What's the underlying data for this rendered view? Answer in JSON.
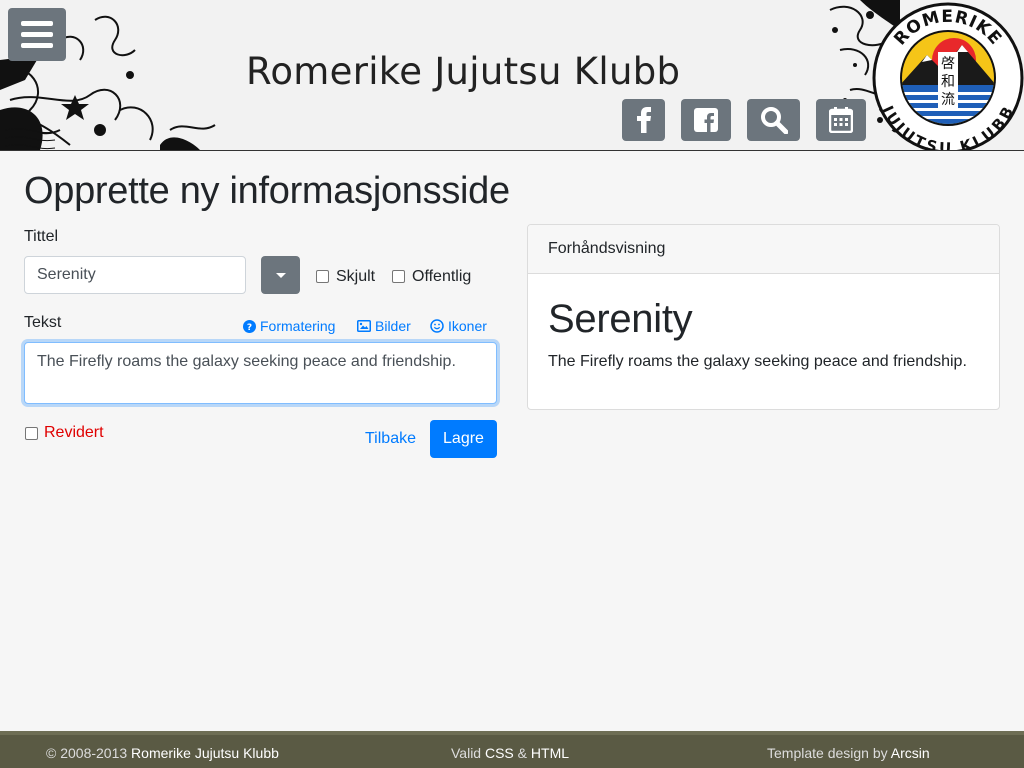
{
  "header": {
    "site_title": "Romerike Jujutsu Klubb",
    "menu_icon": "hamburger-menu-icon",
    "buttons": [
      {
        "icon": "facebook-icon"
      },
      {
        "icon": "facebook-square-icon"
      },
      {
        "icon": "search-icon"
      },
      {
        "icon": "calendar-icon"
      }
    ],
    "logo": {
      "top_text": "ROMERIKE",
      "bottom_text": "JUJUTSU KLUBB",
      "kanji": "啓和流"
    }
  },
  "form": {
    "heading": "Opprette ny informasjonsside",
    "title_label": "Tittel",
    "title_value": "Serenity",
    "hidden_label": "Skjult",
    "public_label": "Offentlig",
    "text_label": "Tekst",
    "toolbar": {
      "formatting": "Formatering",
      "images": "Bilder",
      "icons": "Ikoner"
    },
    "text_value": "The Firefly roams the galaxy seeking peace and friendship.",
    "revised_label": "Revidert",
    "back_label": "Tilbake",
    "save_label": "Lagre"
  },
  "preview": {
    "header": "Forhåndsvisning",
    "title": "Serenity",
    "body": "The Firefly roams the galaxy seeking peace and friendship."
  },
  "footer": {
    "copyright_prefix": "© 2008-2013 ",
    "copyright_name": "Romerike Jujutsu Klubb",
    "valid_prefix": "Valid ",
    "valid_css": "CSS",
    "valid_amp": " & ",
    "valid_html": "HTML",
    "template_prefix": "Template design by ",
    "template_name": "Arcsin"
  },
  "colors": {
    "primary": "#007bff",
    "secondary": "#6c757d",
    "danger": "#e00000",
    "footer_bg": "#5a5a44"
  }
}
